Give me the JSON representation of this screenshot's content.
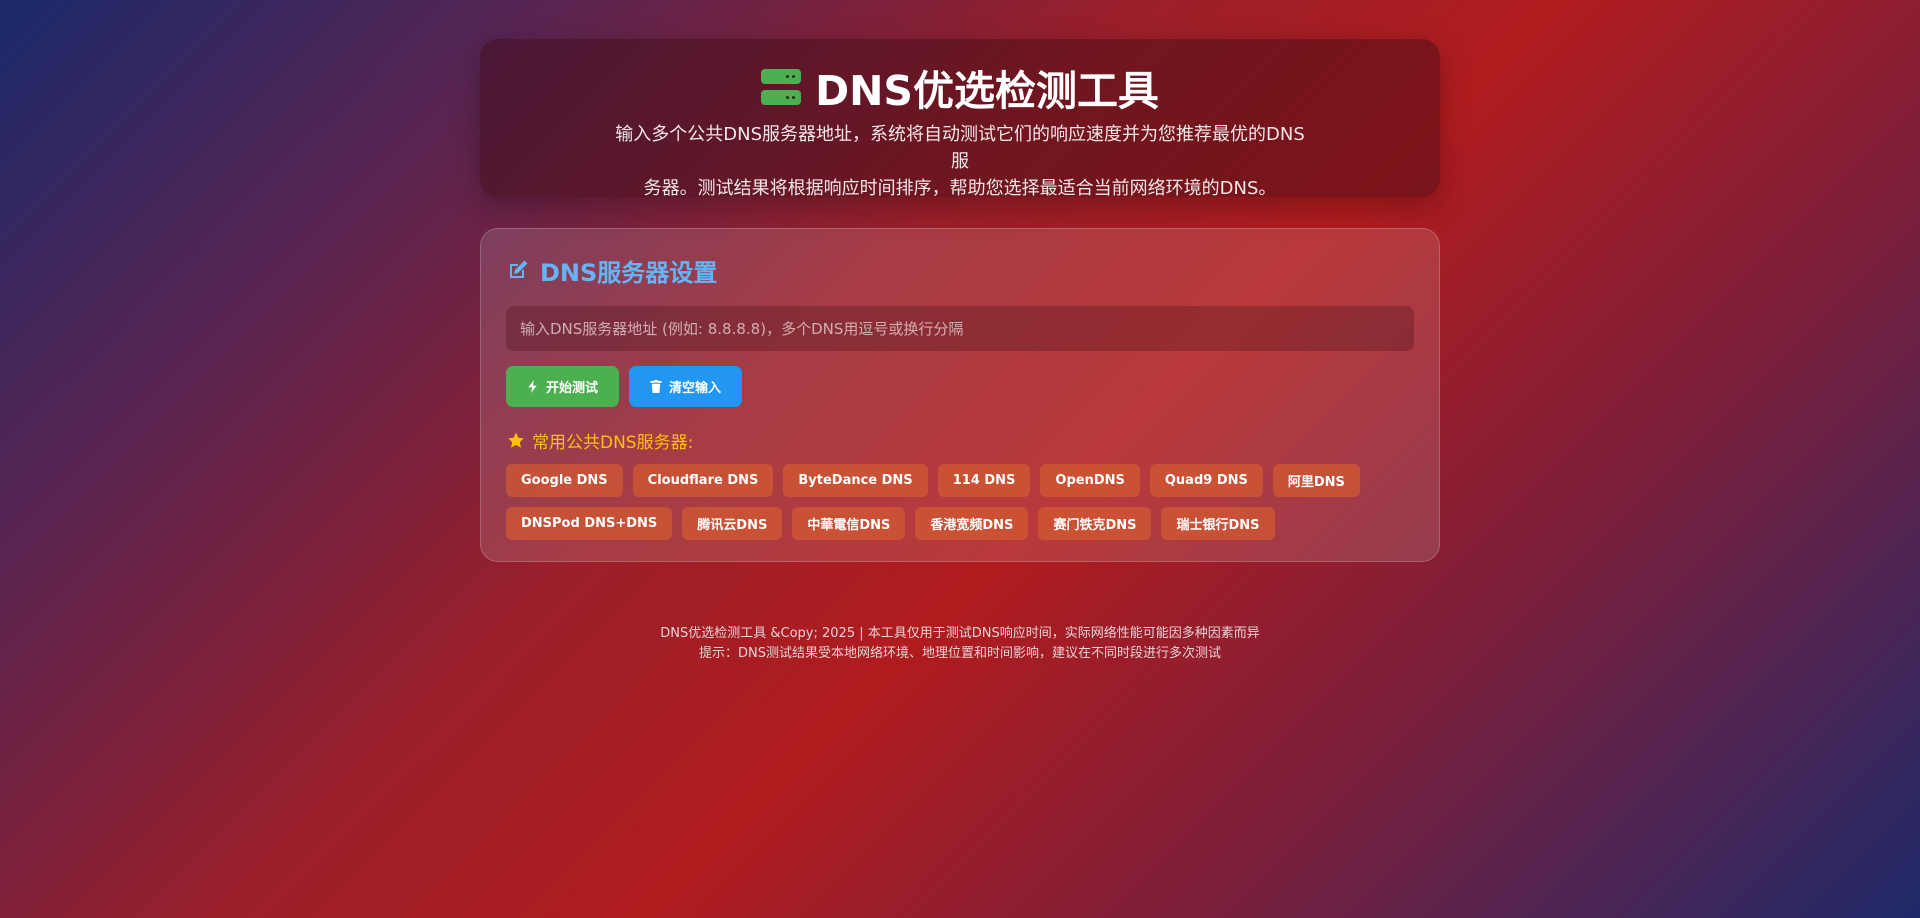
{
  "header": {
    "title": "DNS优选检测工具",
    "icon": "server-icon",
    "subtitle_line1": "输入多个公共DNS服务器地址，系统将自动测试它们的响应速度并为您推荐最优的DNS服",
    "subtitle_line2": "务器。测试结果将根据响应时间排序，帮助您选择最适合当前网络环境的DNS。"
  },
  "settings": {
    "title": "DNS服务器设置",
    "title_icon": "edit-icon",
    "input": {
      "value": "",
      "placeholder": "输入DNS服务器地址 (例如: 8.8.8.8)，多个DNS用逗号或换行分隔"
    },
    "buttons": {
      "start_label": "开始测试",
      "start_icon": "bolt-icon",
      "clear_label": "清空输入",
      "clear_icon": "trash-icon"
    },
    "common": {
      "title": "常用公共DNS服务器:",
      "icon": "star-icon",
      "items": [
        "Google DNS",
        "Cloudflare DNS",
        "ByteDance DNS",
        "114 DNS",
        "OpenDNS",
        "Quad9 DNS",
        "阿里DNS",
        "DNSPod DNS+DNS",
        "腾讯云DNS",
        "中華電信DNS",
        "香港宽频DNS",
        "赛门铁克DNS",
        "瑞士银行DNS"
      ]
    }
  },
  "footer": {
    "line1": "DNS优选检测工具 &Copy; 2025 | 本工具仅用于测试DNS响应时间，实际网络性能可能因多种因素而异",
    "line2": "提示：DNS测试结果受本地网络环境、地理位置和时间影响，建议在不同时段进行多次测试"
  },
  "colors": {
    "accent_green": "#4caf50",
    "accent_blue": "#2196f3",
    "section_title": "#64b5f6",
    "common_title": "#ffc107",
    "chip_bg": "#d25a32"
  }
}
